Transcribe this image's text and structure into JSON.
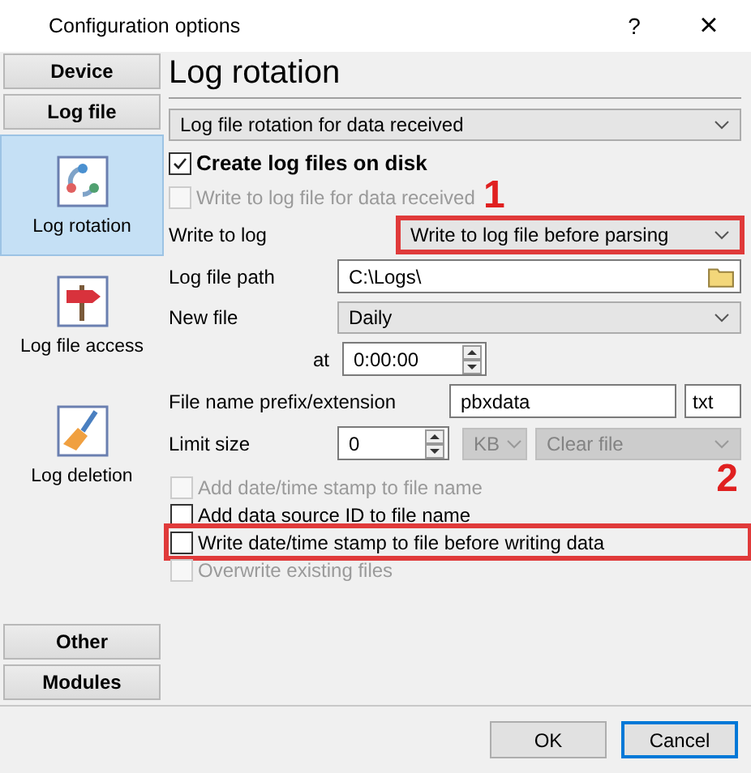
{
  "window": {
    "title": "Configuration options",
    "help": "?",
    "close": "×"
  },
  "sidebar": {
    "top": [
      {
        "label": "Device"
      },
      {
        "label": "Log file"
      }
    ],
    "pages": [
      {
        "label": "Log rotation",
        "selected": true
      },
      {
        "label": "Log file access",
        "selected": false
      },
      {
        "label": "Log deletion",
        "selected": false
      }
    ],
    "bottom": [
      {
        "label": "Other"
      },
      {
        "label": "Modules"
      }
    ]
  },
  "heading": "Log rotation",
  "mode_select": {
    "value": "Log file rotation for data received"
  },
  "create_files": {
    "label": "Create log files on disk",
    "checked": true,
    "disabled": false
  },
  "write_received": {
    "label": "Write to log file for data received",
    "checked": false,
    "disabled": true
  },
  "write_to_log": {
    "label": "Write to log",
    "value": "Write to log file before parsing",
    "highlighted": true,
    "callout": "1"
  },
  "path": {
    "label": "Log file path",
    "value": "C:\\Logs\\"
  },
  "new_file": {
    "label": "New file",
    "value": "Daily"
  },
  "at": {
    "label": "at",
    "value": "0:00:00"
  },
  "prefix": {
    "label": "File name prefix/extension",
    "value": "pbxdata",
    "extension": "txt"
  },
  "limit": {
    "label": "Limit size",
    "value": "0",
    "unit": "KB",
    "unit_disabled": true,
    "action": "Clear file",
    "action_disabled": true
  },
  "options": [
    {
      "label": "Add date/time stamp to file name",
      "checked": false,
      "disabled": true,
      "highlighted": false
    },
    {
      "label": "Add data source ID to file name",
      "checked": false,
      "disabled": false,
      "highlighted": false
    },
    {
      "label": "Write date/time stamp to file before writing data",
      "checked": false,
      "disabled": false,
      "highlighted": true,
      "callout": "2"
    },
    {
      "label": "Overwrite existing files",
      "checked": false,
      "disabled": true,
      "highlighted": false
    }
  ],
  "buttons": [
    {
      "label": "OK",
      "focused": false
    },
    {
      "label": "Cancel",
      "focused": true
    }
  ]
}
